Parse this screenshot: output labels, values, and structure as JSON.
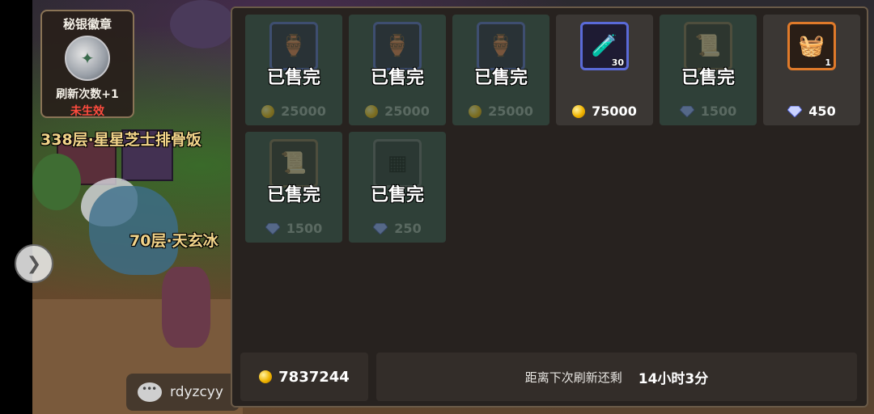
{
  "badge": {
    "title": "秘银徽章",
    "line1": "刷新次数+1",
    "line2": "未生效"
  },
  "world": {
    "floor_labels": [
      "338层·星星芝士排骨饭",
      "70层·天玄冰"
    ]
  },
  "chat": {
    "username": "rdyzcyy"
  },
  "shop": {
    "sold_out_label": "已售完",
    "items": [
      {
        "status": "sold_out",
        "currency": "coin",
        "price": "25000",
        "frame": "blue",
        "icon": "jar-icon"
      },
      {
        "status": "sold_out",
        "currency": "coin",
        "price": "25000",
        "frame": "blue",
        "icon": "jar-icon"
      },
      {
        "status": "sold_out",
        "currency": "coin",
        "price": "25000",
        "frame": "blue",
        "icon": "jar-icon"
      },
      {
        "status": "available",
        "currency": "coin",
        "price": "75000",
        "frame": "blue",
        "icon": "potion-icon",
        "qty": "30"
      },
      {
        "status": "sold_out",
        "currency": "gem",
        "price": "1500",
        "frame": "brown",
        "icon": "scroll-icon"
      },
      {
        "status": "available",
        "currency": "gem",
        "price": "450",
        "frame": "orange",
        "icon": "food-basket-icon",
        "qty": "1"
      },
      {
        "status": "sold_out",
        "currency": "gem",
        "price": "1500",
        "frame": "brown",
        "icon": "scroll-icon"
      },
      {
        "status": "sold_out",
        "currency": "gem",
        "price": "250",
        "frame": "gray",
        "icon": "net-icon"
      }
    ]
  },
  "footer": {
    "gold_balance": "7837244",
    "refresh_label": "距离下次刷新还剩",
    "refresh_time": "14小时3分"
  },
  "colors": {
    "panel_bg": "#27221f",
    "sold_card": "#2f4038",
    "active_card": "#3b3734",
    "badge_red": "#ff4b3e"
  }
}
